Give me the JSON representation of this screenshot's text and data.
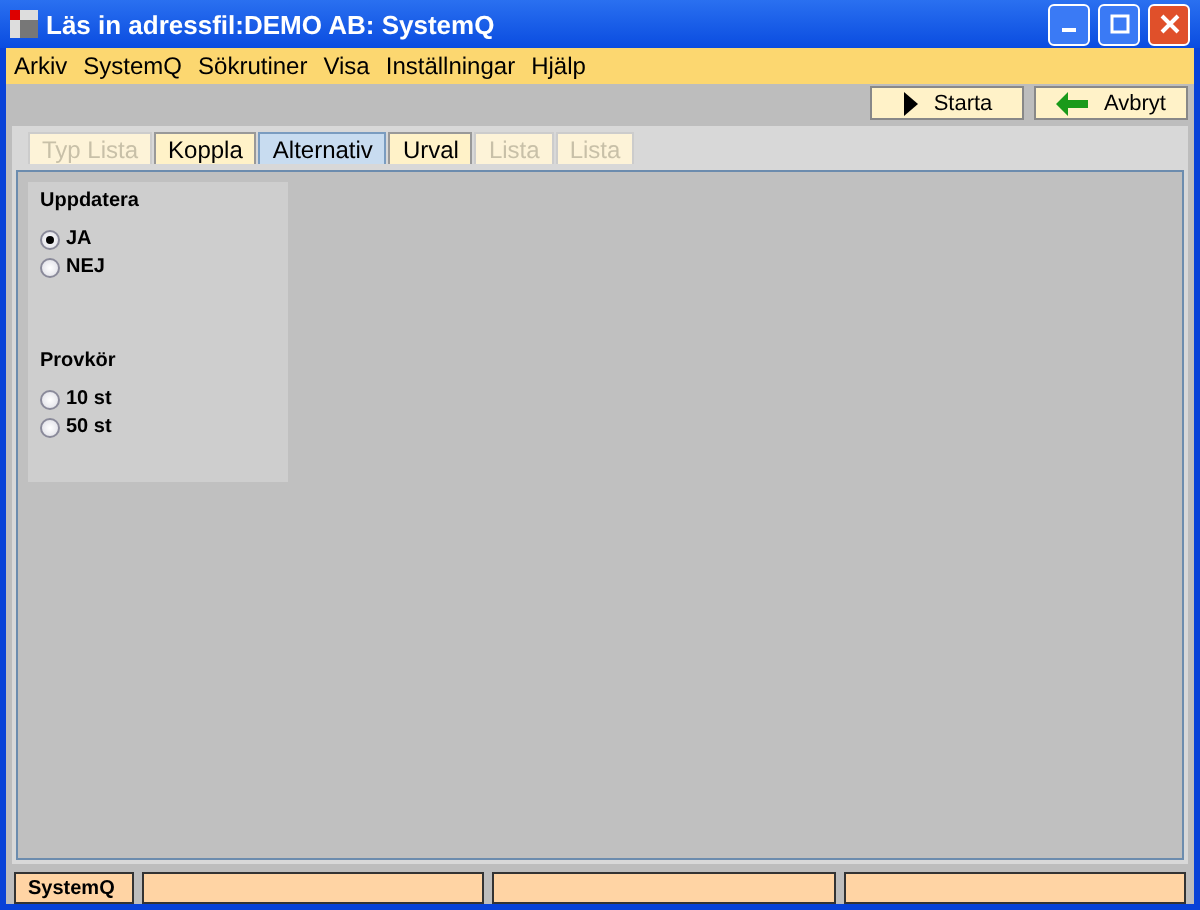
{
  "window": {
    "title": "Läs in adressfil:DEMO AB: SystemQ"
  },
  "menu": [
    "Arkiv",
    "SystemQ",
    "Sökrutiner",
    "Visa",
    "Inställningar",
    "Hjälp"
  ],
  "toolbar": [
    {
      "kind": "play",
      "label": "Starta"
    },
    {
      "kind": "back",
      "label": "Avbryt"
    }
  ],
  "tabs": [
    {
      "label": "Typ Lista",
      "selected": false,
      "disabled": true
    },
    {
      "label": "Koppla",
      "selected": false,
      "disabled": false
    },
    {
      "label": "Alternativ",
      "selected": true,
      "disabled": false
    },
    {
      "label": "Urval",
      "selected": false,
      "disabled": false
    },
    {
      "label": "Lista",
      "selected": false,
      "disabled": true
    },
    {
      "label": "Lista",
      "selected": false,
      "disabled": true
    }
  ],
  "groups": [
    {
      "title": "Uppdatera",
      "options": [
        {
          "label": "JA",
          "selected": true
        },
        {
          "label": "NEJ",
          "selected": false
        }
      ]
    },
    {
      "title": "Provkör",
      "options": [
        {
          "label": "10 st",
          "selected": false
        },
        {
          "label": "50 st",
          "selected": false
        }
      ]
    }
  ],
  "status_bar": {
    "label": "SystemQ"
  }
}
